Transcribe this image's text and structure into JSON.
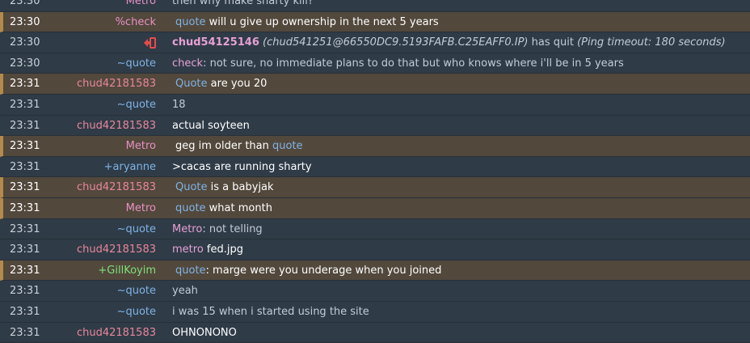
{
  "colors": {
    "background": "#2f3b47",
    "highlight_bg": "#52483c",
    "highlight_bar": "#b38a4e",
    "quote": "#7fb3e6",
    "aryanne": "#7fb3e6",
    "chud": "#e8879a",
    "metro": "#e890c4",
    "check": "#e890c4",
    "gillkoyim": "#7ee07a",
    "quit_icon": "#e84b4b"
  },
  "messages": [
    {
      "time": "23:30",
      "nick": "Metro",
      "nick_color": "#e890c4",
      "highlight": false,
      "partial": true,
      "parts": [
        {
          "text": "then why make sharty kill?",
          "cls": ""
        }
      ]
    },
    {
      "time": "23:30",
      "nick": "%check",
      "nick_color": "#e890c4",
      "highlight": true,
      "parts": [
        {
          "text": "quote",
          "cls": "mention-quote"
        },
        {
          "text": " will u give up ownership in the next 5 years",
          "cls": ""
        }
      ]
    },
    {
      "time": "23:30",
      "nick": "",
      "nick_icon": "quit-icon",
      "nick_color": "#e84b4b",
      "highlight": false,
      "quit": true,
      "quit_nick": "chud54125146",
      "quit_host": "(chud541251@66550DC9.5193FAFB.C25EAFF0.IP)",
      "quit_text": "has quit",
      "quit_reason": "(Ping timeout: 180 seconds)"
    },
    {
      "time": "23:30",
      "nick": "~quote",
      "nick_color": "#7fb3e6",
      "highlight": false,
      "parts": [
        {
          "text": "check",
          "cls": "mention-check"
        },
        {
          "text": ": not sure, no immediate plans to do that but who knows where i'll be in 5 years",
          "cls": ""
        }
      ]
    },
    {
      "time": "23:31",
      "nick": "chud42181583",
      "nick_color": "#e8879a",
      "highlight": true,
      "parts": [
        {
          "text": "Quote",
          "cls": "mention-quote"
        },
        {
          "text": " are you 20",
          "cls": ""
        }
      ]
    },
    {
      "time": "23:31",
      "nick": "~quote",
      "nick_color": "#7fb3e6",
      "highlight": false,
      "parts": [
        {
          "text": "18",
          "cls": ""
        }
      ]
    },
    {
      "time": "23:31",
      "nick": "chud42181583",
      "nick_color": "#e8879a",
      "highlight": false,
      "parts": [
        {
          "text": "actual soyteen",
          "cls": "bright"
        }
      ]
    },
    {
      "time": "23:31",
      "nick": "Metro",
      "nick_color": "#e890c4",
      "highlight": true,
      "parts": [
        {
          "text": "geg im older than ",
          "cls": ""
        },
        {
          "text": "quote",
          "cls": "mention-quote"
        }
      ]
    },
    {
      "time": "23:31",
      "nick": "+aryanne",
      "nick_color": "#7fb3e6",
      "highlight": false,
      "parts": [
        {
          "text": ">cacas are running sharty",
          "cls": "bright"
        }
      ]
    },
    {
      "time": "23:31",
      "nick": "chud42181583",
      "nick_color": "#e8879a",
      "highlight": true,
      "parts": [
        {
          "text": "Quote",
          "cls": "mention-quote"
        },
        {
          "text": " is a babyjak",
          "cls": ""
        }
      ]
    },
    {
      "time": "23:31",
      "nick": "Metro",
      "nick_color": "#e890c4",
      "highlight": true,
      "parts": [
        {
          "text": "quote",
          "cls": "mention-quote"
        },
        {
          "text": " what month",
          "cls": ""
        }
      ]
    },
    {
      "time": "23:31",
      "nick": "~quote",
      "nick_color": "#7fb3e6",
      "highlight": false,
      "parts": [
        {
          "text": "Metro",
          "cls": "mention-metro"
        },
        {
          "text": ": not telling",
          "cls": ""
        }
      ]
    },
    {
      "time": "23:31",
      "nick": "chud42181583",
      "nick_color": "#e8879a",
      "highlight": false,
      "parts": [
        {
          "text": "metro",
          "cls": "mention-metro"
        },
        {
          "text": " fed.jpg",
          "cls": "bright"
        }
      ]
    },
    {
      "time": "23:31",
      "nick": "+GillKoyim",
      "nick_color": "#7ee07a",
      "highlight": true,
      "parts": [
        {
          "text": "quote",
          "cls": "mention-quote"
        },
        {
          "text": ": marge were you underage when you joined",
          "cls": ""
        }
      ]
    },
    {
      "time": "23:31",
      "nick": "~quote",
      "nick_color": "#7fb3e6",
      "highlight": false,
      "parts": [
        {
          "text": "yeah",
          "cls": ""
        }
      ]
    },
    {
      "time": "23:31",
      "nick": "~quote",
      "nick_color": "#7fb3e6",
      "highlight": false,
      "parts": [
        {
          "text": "i was 15 when i started using the site",
          "cls": ""
        }
      ]
    },
    {
      "time": "23:31",
      "nick": "chud42181583",
      "nick_color": "#e8879a",
      "highlight": false,
      "parts": [
        {
          "text": "OHNONONO",
          "cls": "bright"
        }
      ]
    }
  ]
}
